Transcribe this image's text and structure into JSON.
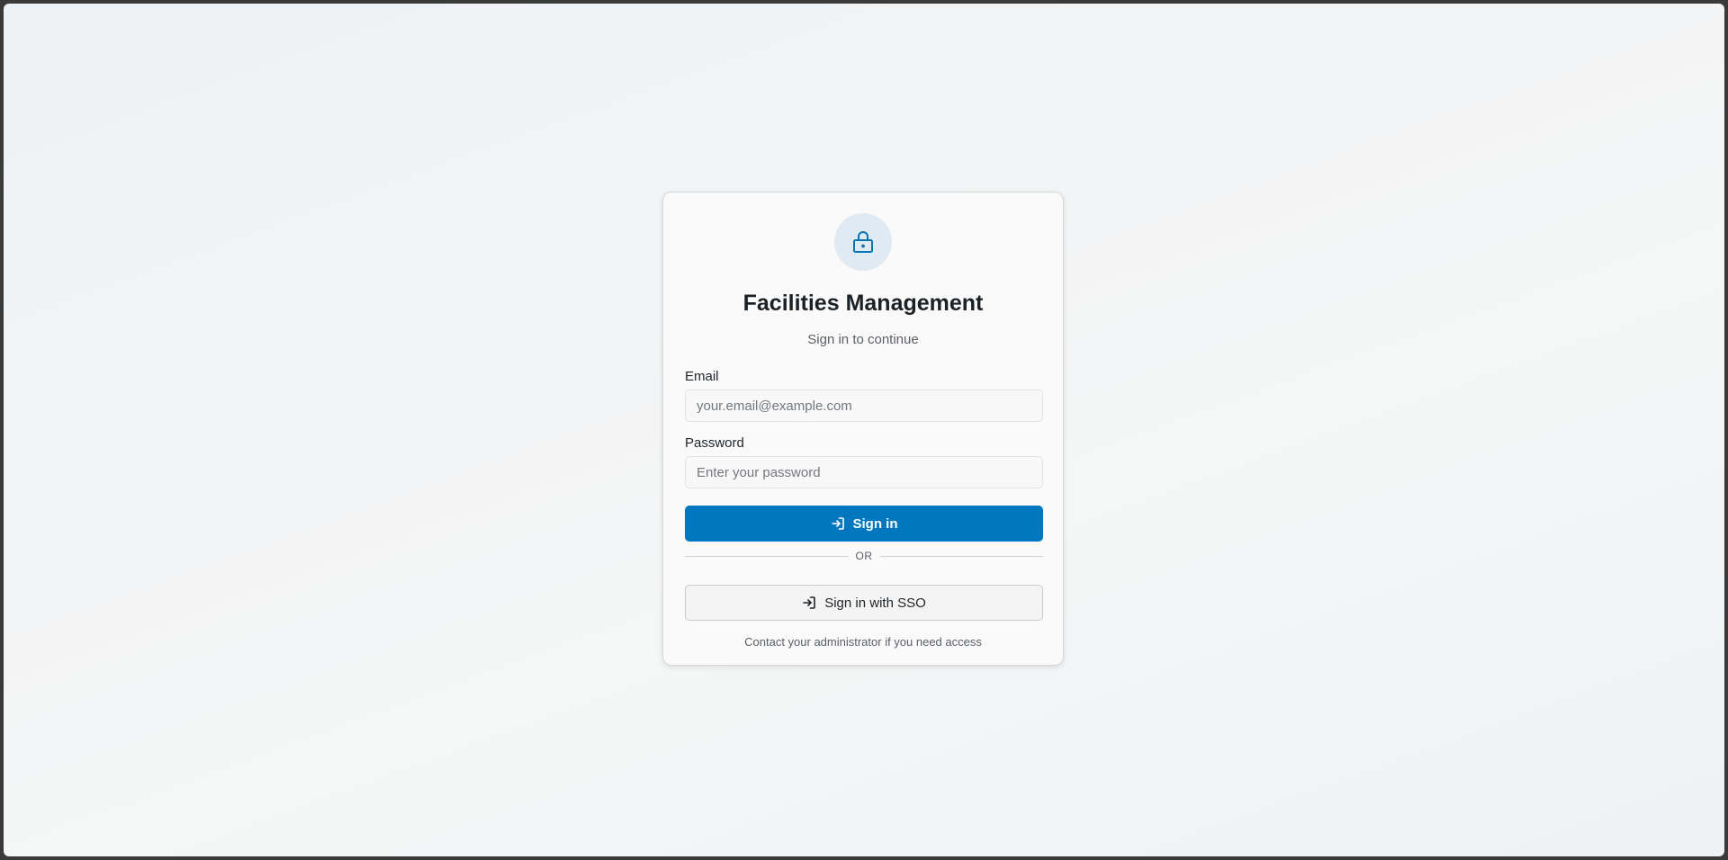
{
  "app": {
    "title": "Facilities Management",
    "subtitle": "Sign in to continue"
  },
  "header_icon": "lock-icon",
  "form": {
    "email": {
      "label": "Email",
      "placeholder": "your.email@example.com",
      "value": ""
    },
    "password": {
      "label": "Password",
      "placeholder": "Enter your password",
      "value": ""
    },
    "sign_in_label": "Sign in",
    "sign_in_icon": "login-icon",
    "divider_text": "OR",
    "sso_label": "Sign in with SSO",
    "sso_icon": "login-icon"
  },
  "footer": {
    "note": "Contact your administrator if you need access"
  },
  "colors": {
    "primary": "#0077be",
    "icon_bg": "#dfeaf3",
    "title_text": "#1c2126"
  }
}
